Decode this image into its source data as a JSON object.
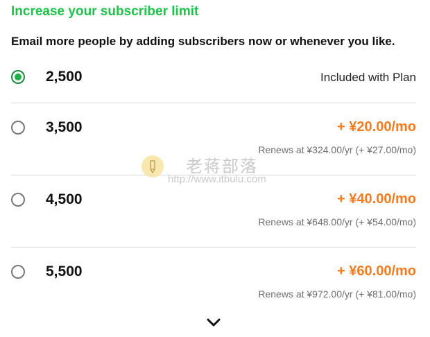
{
  "header": {
    "title": "Increase your subscriber limit",
    "subtitle": "Email more people by adding subscribers now or whenever you like."
  },
  "options": [
    {
      "count": "2,500",
      "note": "Included with Plan",
      "selected": true
    },
    {
      "count": "3,500",
      "price": "+ ¥20.00/mo",
      "renews": "Renews at ¥324.00/yr (+ ¥27.00/mo)",
      "selected": false
    },
    {
      "count": "4,500",
      "price": "+ ¥40.00/mo",
      "renews": "Renews at ¥648.00/yr (+ ¥54.00/mo)",
      "selected": false
    },
    {
      "count": "5,500",
      "price": "+ ¥60.00/mo",
      "renews": "Renews at ¥972.00/yr (+ ¥81.00/mo)",
      "selected": false
    }
  ],
  "watermark": {
    "name": "老蒋部落",
    "url": "http://www.itbulu.com"
  },
  "colors": {
    "title_green": "#1fc24a",
    "radio_selected": "#1fb046",
    "price_orange": "#f47b20",
    "muted_text": "#6e6e6e"
  },
  "icons": {
    "expand": "chevron-down-icon",
    "watermark_logo": "pencil-logo-icon"
  }
}
